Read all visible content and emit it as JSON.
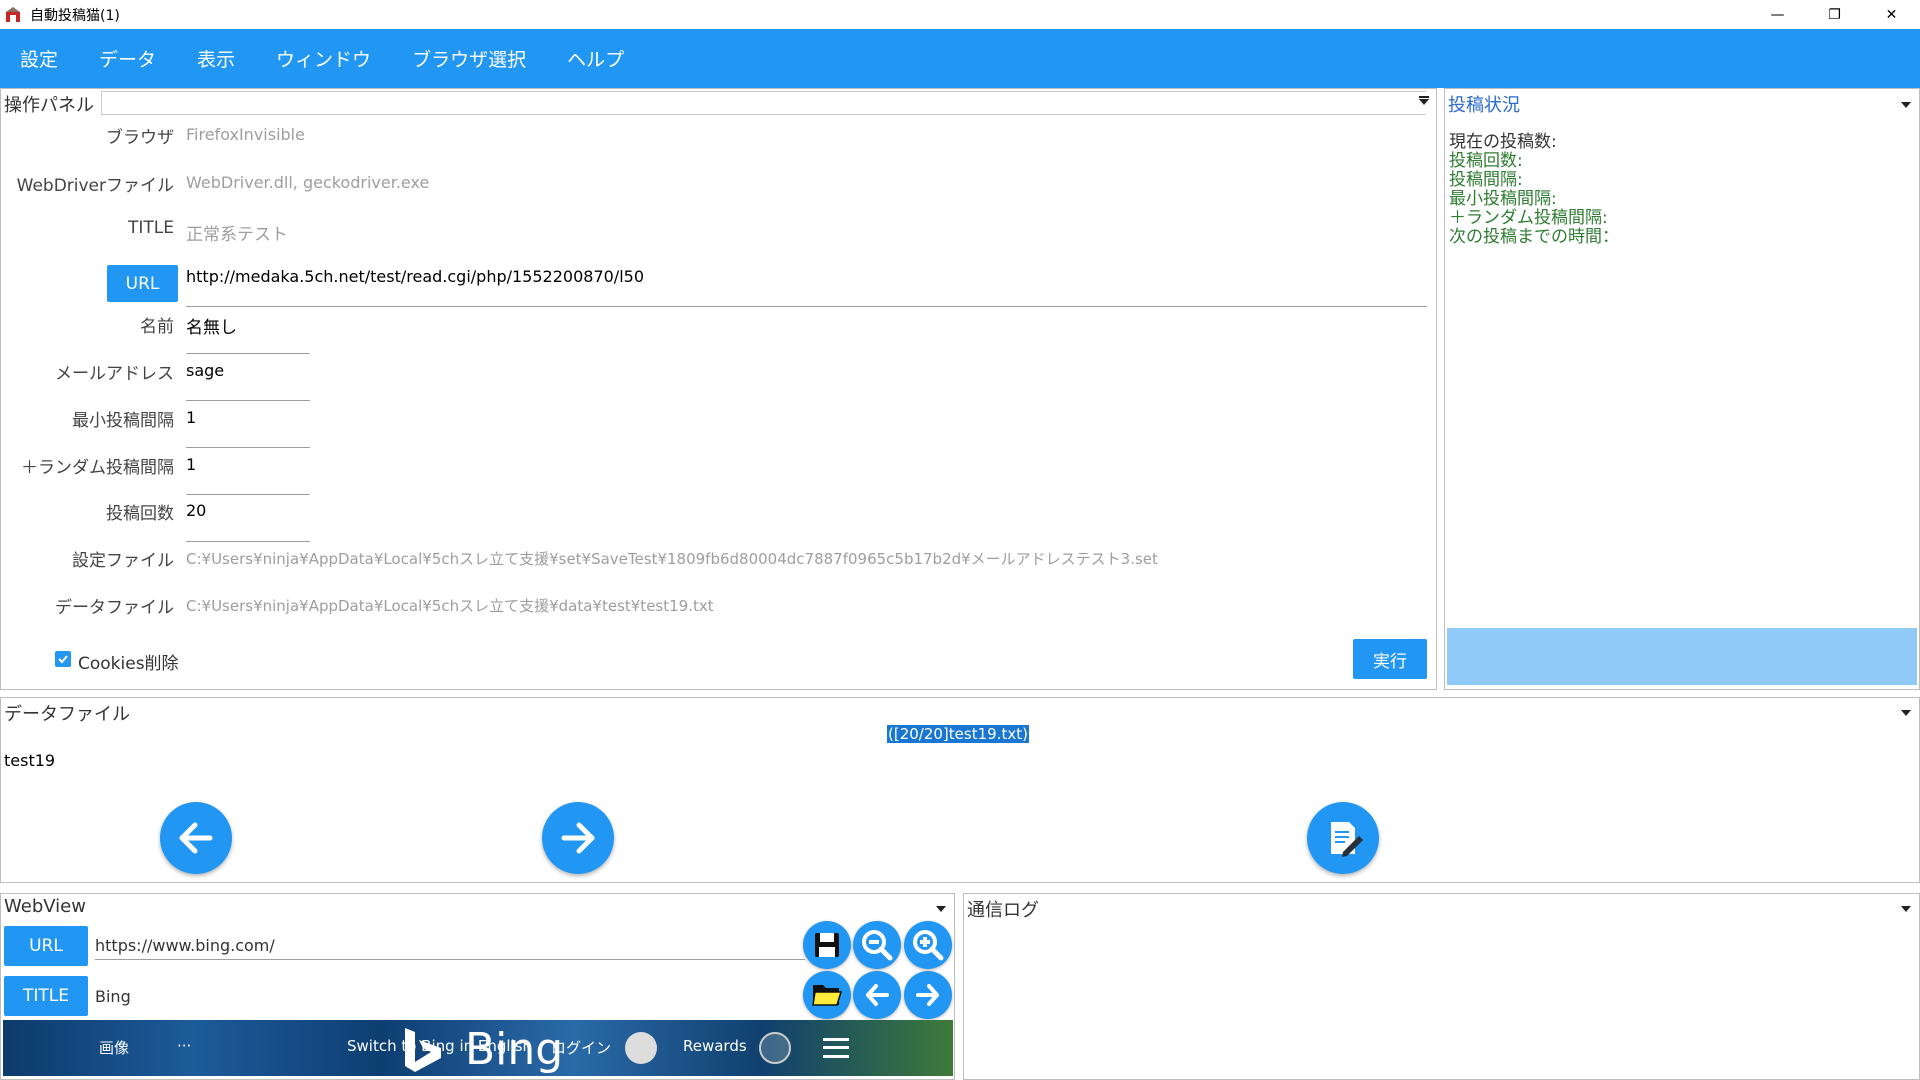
{
  "window": {
    "title": "自動投稿猫(1)",
    "minimize": "—",
    "restore": "❐",
    "close": "✕"
  },
  "menu": [
    "設定",
    "データ",
    "表示",
    "ウィンドウ",
    "ブラウザ選択",
    "ヘルプ"
  ],
  "op_panel": {
    "title": "操作パネル",
    "browser_label": "ブラウザ",
    "browser_value": "FirefoxInvisible",
    "webdriver_label": "WebDriverファイル",
    "webdriver_value": "WebDriver.dll, geckodriver.exe",
    "title_label": "TITLE",
    "title_value": "正常系テスト",
    "url_button": "URL",
    "url_value": "http://medaka.5ch.net/test/read.cgi/php/1552200870/l50",
    "name_label": "名前",
    "name_value": "名無し",
    "mail_label": "メールアドレス",
    "mail_value": "sage",
    "min_interval_label": "最小投稿間隔",
    "min_interval_value": "1",
    "rand_interval_label": "＋ランダム投稿間隔",
    "rand_interval_value": "1",
    "count_label": "投稿回数",
    "count_value": "20",
    "settings_file_label": "設定ファイル",
    "settings_file_value": "C:¥Users¥ninja¥AppData¥Local¥5chスレ立て支援¥set¥SaveTest¥1809fb6d80004dc7887f0965c5b17b2d¥メールアドレステスト3.set",
    "data_file_label": "データファイル",
    "data_file_value": "C:¥Users¥ninja¥AppData¥Local¥5chスレ立て支援¥data¥test¥test19.txt",
    "cookies_label": "Cookies削除",
    "cookies_checked": true,
    "run_button": "実行"
  },
  "status_panel": {
    "title": "投稿状況",
    "lines": [
      "現在の投稿数:",
      "投稿回数:",
      "投稿間隔:",
      "最小投稿間隔:",
      "＋ランダム投稿間隔:",
      "次の投稿までの時間："
    ],
    "progress": 1.0
  },
  "data_panel": {
    "title": "データファイル",
    "file_tag": "([20/20]test19.txt)",
    "content": "test19"
  },
  "webview": {
    "title": "WebView",
    "url_button": "URL",
    "url_value": "https://www.bing.com/",
    "title_button": "TITLE",
    "title_value": "Bing",
    "bing": {
      "images": "画像",
      "more": "···",
      "switch": "Switch to Bing in English",
      "logo": "Bing",
      "login": "ログイン",
      "rewards": "Rewards"
    }
  },
  "log_panel": {
    "title": "通信ログ"
  },
  "colors": {
    "accent": "#2196f3",
    "progress": "#90caf9"
  }
}
